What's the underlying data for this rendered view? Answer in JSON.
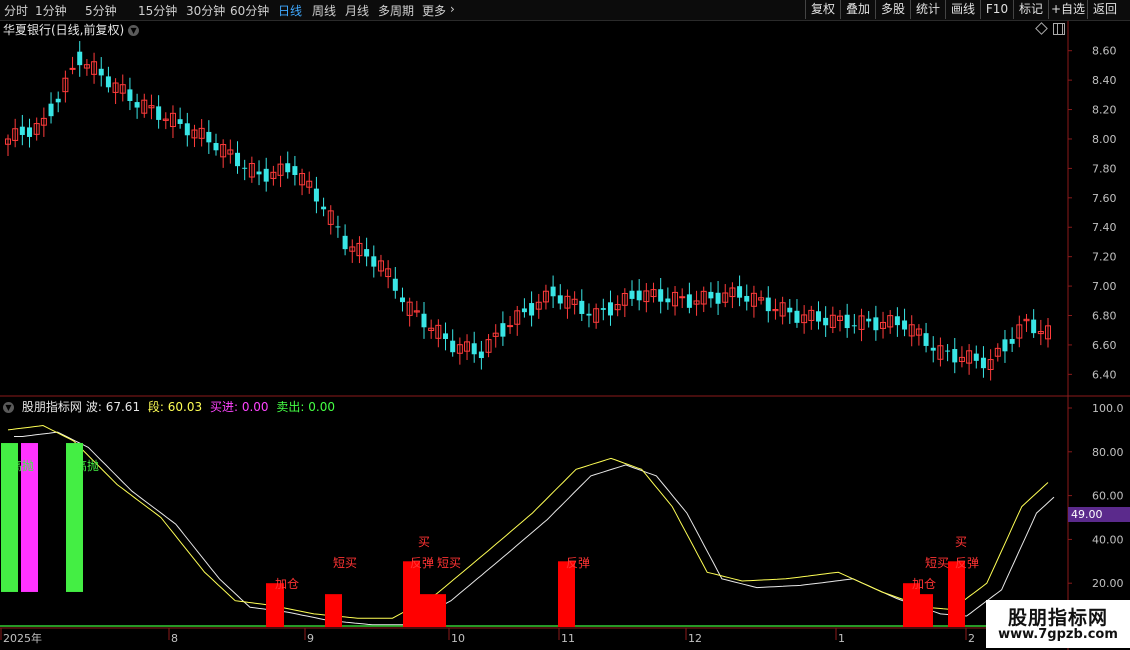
{
  "toolbar": {
    "periods": [
      "分时",
      "1分钟",
      "5分钟",
      "15分钟",
      "30分钟",
      "60分钟",
      "日线",
      "周线",
      "月线",
      "多周期",
      "更多"
    ],
    "active_period": "日线",
    "buttons": [
      "复权",
      "叠加",
      "多股",
      "统计",
      "画线",
      "F10",
      "标记",
      "+自选",
      "返回"
    ]
  },
  "main_chart": {
    "title": "华夏银行(日线,前复权)",
    "y_ticks": [
      "8.60",
      "8.40",
      "8.20",
      "8.00",
      "7.80",
      "7.60",
      "7.40",
      "7.20",
      "7.00",
      "6.80",
      "6.60",
      "6.40"
    ],
    "y_range": [
      6.28,
      8.7
    ],
    "up_color": "#ff3b3b",
    "down_color": "#39e6e6"
  },
  "indicator": {
    "name": "股朋指标网",
    "wave_label": "波:",
    "wave_value": "67.61",
    "seg_label": "段:",
    "seg_value": "60.03",
    "buy_label": "买进:",
    "buy_value": "0.00",
    "sell_label": "卖出:",
    "sell_value": "0.00",
    "y_ticks": [
      "100.0",
      "80.00",
      "60.00",
      "40.00",
      "20.00"
    ],
    "y_range": [
      0,
      100
    ],
    "cursor_value": "49.00",
    "signals": [
      "高抛",
      "短卖",
      "加仓",
      "短买",
      "买",
      "反弹"
    ]
  },
  "x_axis": {
    "labels": [
      "2025年",
      "8",
      "9",
      "10",
      "11",
      "12",
      "1",
      "2"
    ]
  },
  "watermark": {
    "line1": "股朋指标网",
    "line2": "www.7gpzb.com"
  }
}
